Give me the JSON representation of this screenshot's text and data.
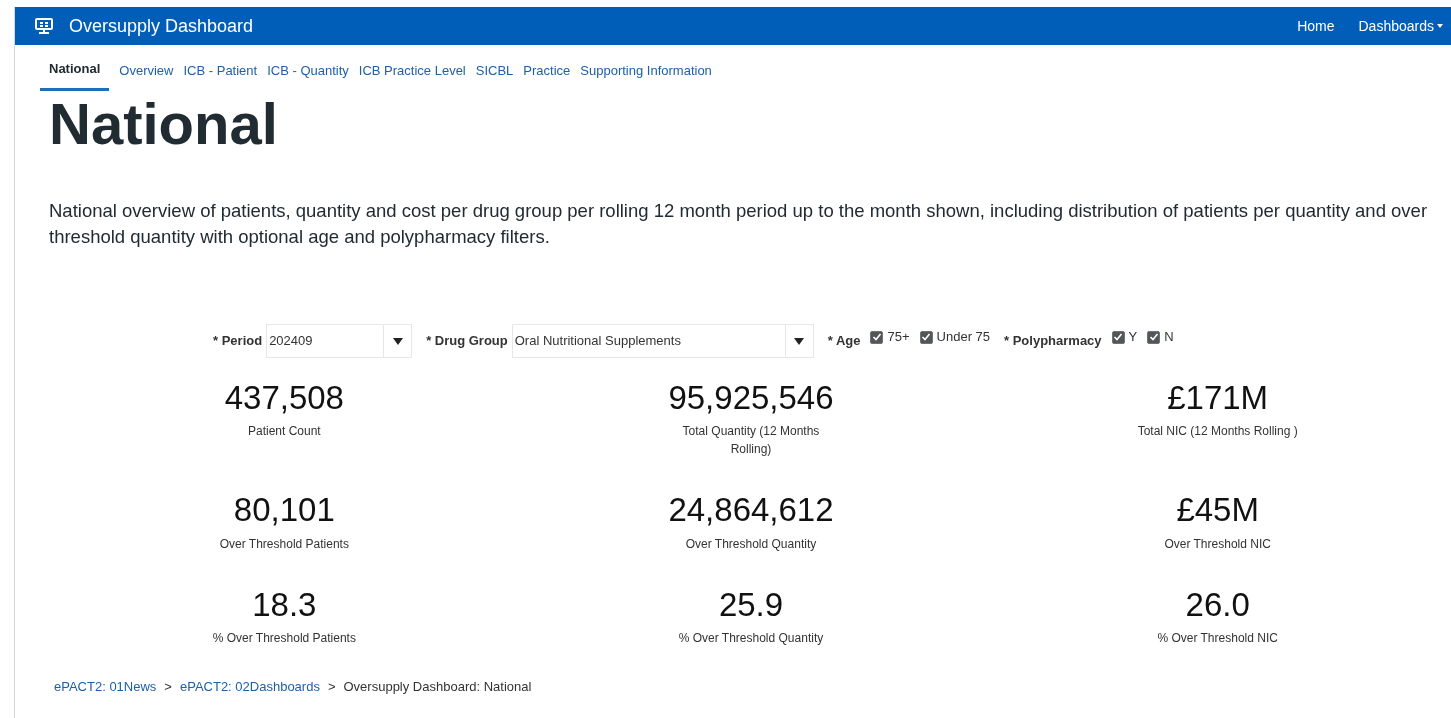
{
  "header": {
    "title": "Oversupply Dashboard",
    "nav": [
      {
        "label": "Home",
        "dropdown": false
      },
      {
        "label": "Dashboards",
        "dropdown": true
      }
    ]
  },
  "tabs": [
    {
      "label": "National",
      "selected": true
    },
    {
      "label": "Overview",
      "selected": false
    },
    {
      "label": "ICB - Patient",
      "selected": false
    },
    {
      "label": "ICB - Quantity",
      "selected": false
    },
    {
      "label": "ICB Practice Level",
      "selected": false
    },
    {
      "label": "SICBL",
      "selected": false
    },
    {
      "label": "Practice",
      "selected": false
    },
    {
      "label": "Supporting Information",
      "selected": false
    }
  ],
  "page_title": "National",
  "description": "National overview of patients, quantity and cost per drug group per rolling 12 month period up to the month shown, including distribution of patients per quantity and over threshold quantity with optional age and polypharmacy filters.",
  "filters": [
    {
      "kind": "select",
      "label": "* Period",
      "value": "202409"
    },
    {
      "kind": "select",
      "label": "* Drug Group",
      "value": "Oral Nutritional Supplements"
    },
    {
      "kind": "checks",
      "label": "* Age",
      "options": [
        {
          "label": "75+",
          "checked": true
        },
        {
          "label": "Under 75",
          "checked": true
        }
      ]
    },
    {
      "kind": "checks",
      "label": "* Polypharmacy",
      "options": [
        {
          "label": "Y",
          "checked": true
        },
        {
          "label": "N",
          "checked": true
        }
      ]
    }
  ],
  "metrics": [
    {
      "value": "437,508",
      "label": "Patient Count"
    },
    {
      "value": "95,925,546",
      "label": "Total Quantity (12 Months Rolling)"
    },
    {
      "value": "£171M",
      "label": "Total NIC (12 Months Rolling )"
    },
    {
      "value": "80,101",
      "label": "Over Threshold Patients"
    },
    {
      "value": "24,864,612",
      "label": "Over Threshold Quantity"
    },
    {
      "value": "£45M",
      "label": "Over Threshold NIC"
    },
    {
      "value": "18.3",
      "label": "% Over Threshold Patients"
    },
    {
      "value": "25.9",
      "label": "% Over Threshold Quantity"
    },
    {
      "value": "26.0",
      "label": "% Over Threshold NIC"
    }
  ],
  "breadcrumb": [
    {
      "label": "ePACT2: 01News",
      "link": true
    },
    {
      "separator": ">"
    },
    {
      "label": "ePACT2: 02Dashboards",
      "link": true
    },
    {
      "separator": ">"
    },
    {
      "label": "Oversupply Dashboard: National",
      "link": false
    }
  ]
}
